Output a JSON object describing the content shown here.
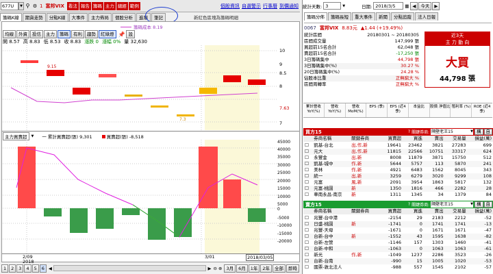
{
  "topbar": {
    "stock_input": "677U",
    "code_prefix": "1",
    "stock_name": "富邦VIX",
    "tool_buttons": [
      "看法",
      "報告",
      "籌碼",
      "主力",
      "總經",
      "範例"
    ],
    "links": [
      "個股資訊",
      "自選警示",
      "行事曆",
      "到價通知"
    ]
  },
  "main_tabs": [
    "籌碼K線",
    "期貨走勢",
    "分點K線",
    "大事件",
    "主力佈局",
    "個股分析",
    "進階",
    "筆記"
  ],
  "notice": "新紅色區塊為籌碼明細",
  "sub_toolbar": {
    "buttons": [
      "均線",
      "外資",
      "投信",
      "主力",
      "籌碼",
      "有利",
      "趨勢",
      "紅綠燈"
    ],
    "pick": "設"
  },
  "legend_top": "籌碼成本 8.19",
  "ohlc": {
    "open": "開 8.57",
    "high": "高 8.83",
    "low": "低 8.53",
    "close": "收 8.83",
    "change": "漲跌 0",
    "pct": "漲幅 0%",
    "vol": "量 32,630"
  },
  "price_axis": [
    "10",
    "9",
    "8.5",
    "8",
    "7.63",
    "7"
  ],
  "candle_labels": [
    "9.15",
    "7.3"
  ],
  "lower_panel": {
    "title": "主力買賣超",
    "legend_a": "一 累計買賣超(張) 9,301",
    "legend_b": "買賣超(張) -8,518",
    "axis": [
      "45000",
      "40000",
      "35000",
      "30000",
      "25000",
      "20000",
      "15000",
      "10000",
      "5000",
      "0",
      "-5000",
      "-10000",
      "-15000",
      "-20000"
    ]
  },
  "date_axis": {
    "left": "2/09",
    "left_year": "2018",
    "mid": "3/01",
    "cursor": "2018/03/05"
  },
  "bottom_bar": {
    "pages": [
      "1",
      "2",
      "3",
      "4",
      "5",
      "6"
    ],
    "ranges": [
      "3月",
      "6月",
      "1年",
      "2年",
      "全部",
      "即時"
    ]
  },
  "right_panel": {
    "period_label": "統計天數:",
    "period_value": "3",
    "date_label": "日期:",
    "date_value": "2018/3/5",
    "today_btn": "今天",
    "tabs": [
      "籌碼分佈",
      "籌碼長短",
      "重大事件",
      "新聞",
      "分點追蹤",
      "法人日報"
    ],
    "stock": {
      "code": "0067",
      "name": "富邦VIX",
      "price": "8.83元",
      "change": "▲1.44 (+19.49%)"
    },
    "stats": [
      {
        "k": "統計區間",
        "v": "20180301 ~ 20180305"
      },
      {
        "k": "區間成交量",
        "v": "147,999 張"
      },
      {
        "k": "買超前15名合計",
        "v": "62,048 張"
      },
      {
        "k": "賣超前15名合計",
        "v": "-17,250 張"
      },
      {
        "k": "3日籌碼集中",
        "v": "44,798 張"
      },
      {
        "k": "3日籌碼集中(%)",
        "v": "30.27 %"
      },
      {
        "k": "20日籌碼集中(%)",
        "v": "24.28 %"
      },
      {
        "k": "佔股本比重",
        "v": "正無窮大 %"
      },
      {
        "k": "區間周轉率",
        "v": "正無窮大 %"
      }
    ],
    "badge": {
      "title": "近3天",
      "subtitle": "主 力 動 向",
      "verdict": "大買",
      "amount": "44,798 張"
    },
    "metrics": [
      "累計營收 YoY(%)",
      "營收 YoY(%)",
      "營收 MoM(%)",
      "EPS (季)",
      "EPS (近4季)",
      "本益比",
      "股價 淨值比",
      "殖利率 (%)",
      "ROE (近4季)"
    ],
    "buy_header": {
      "title": "買方15",
      "filter_label": "關鍵券商:",
      "filter_value": "隔壁老王15",
      "btn1": "構",
      "btn2": "自"
    },
    "sell_header": {
      "title": "賣方15",
      "filter_label": "關鍵券商:",
      "filter_value": "隔壁老王15",
      "btn1": "構",
      "btn2": "自"
    },
    "cols": [
      "券商名稱",
      "關鍵券商",
      "買賣超",
      "買進",
      "賣出",
      "交易量",
      "損益(萬)"
    ],
    "buy_rows": [
      [
        "凱基-台北",
        "出,作,新",
        "19641",
        "23462",
        "3821",
        "27283",
        "699"
      ],
      [
        "元大",
        "出,作,新",
        "11815",
        "22566",
        "10751",
        "33317",
        "624"
      ],
      [
        "永豐金",
        "出,新",
        "8008",
        "11879",
        "3871",
        "15750",
        "512"
      ],
      [
        "凱基-城中",
        "作,新",
        "5644",
        "5757",
        "113",
        "5870",
        "241"
      ],
      [
        "美林",
        "作,新",
        "4921",
        "6483",
        "1562",
        "8045",
        "343"
      ],
      [
        "統一",
        "出,新",
        "3259",
        "6279",
        "3020",
        "9299",
        "108"
      ],
      [
        "元富",
        "風,新",
        "2091",
        "3954",
        "1863",
        "5817",
        "132"
      ],
      [
        "元富-桃園",
        "新",
        "1350",
        "1816",
        "466",
        "2282",
        "28"
      ],
      [
        "華南永昌-南京",
        "新",
        "1311",
        "1345",
        "34",
        "1379",
        "84"
      ]
    ],
    "sell_rows": [
      [
        "兆豐-台中港",
        "",
        "-2154",
        "29",
        "2183",
        "2212",
        "-52"
      ],
      [
        "日盛-桃園",
        "新",
        "-1741",
        "0",
        "1741",
        "1741",
        "-13"
      ],
      [
        "兆豐-天母",
        "",
        "-1671",
        "0",
        "1671",
        "1671",
        "-47"
      ],
      [
        "台新-台中",
        "新",
        "-1552",
        "43",
        "1595",
        "1638",
        "-82"
      ],
      [
        "台新-左營",
        "",
        "-1146",
        "157",
        "1303",
        "1460",
        "-41"
      ],
      [
        "台新-中和",
        "",
        "-1063",
        "0",
        "1063",
        "1063",
        "-61"
      ],
      [
        "新光",
        "作,新",
        "-1049",
        "1237",
        "2286",
        "3523",
        "-26"
      ],
      [
        "台新-台南",
        "",
        "-990",
        "15",
        "1005",
        "1020",
        "-53"
      ],
      [
        "國票-敦北法人",
        "",
        "-988",
        "557",
        "1545",
        "2102",
        "-57"
      ]
    ]
  }
}
